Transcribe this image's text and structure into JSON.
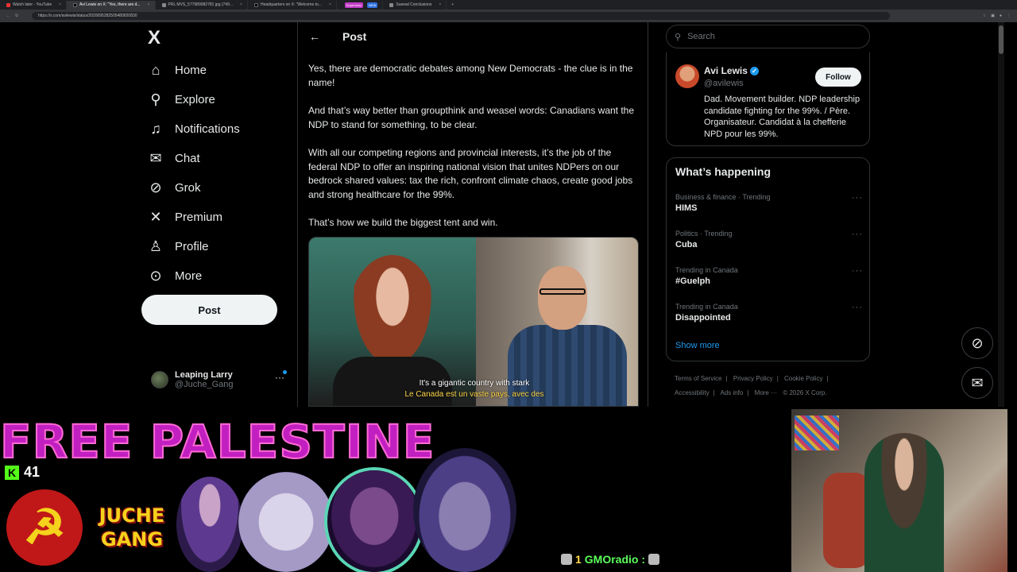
{
  "browser": {
    "tabs": [
      {
        "label": "Watch later - YouTube",
        "active": false
      },
      {
        "label": "Avi Lewis on X: \"Yes, there are d...",
        "active": true
      },
      {
        "label": "PRL MVS_577989082781 jpg (749...",
        "active": false
      },
      {
        "label": "Headquarters on X: \"Welcome to...",
        "active": false
      },
      {
        "label": "Supertonic",
        "active": false
      },
      {
        "label": "Suewal Conclusions",
        "active": false
      }
    ],
    "url": "https://x.com/avilewis/status/2020095282505480820830"
  },
  "sidebar": {
    "logo": "X",
    "nav": [
      {
        "label": "Home",
        "icon": "home-icon"
      },
      {
        "label": "Explore",
        "icon": "search-icon"
      },
      {
        "label": "Notifications",
        "icon": "bell-icon"
      },
      {
        "label": "Chat",
        "icon": "mail-icon"
      },
      {
        "label": "Grok",
        "icon": "grok-icon"
      },
      {
        "label": "Premium",
        "icon": "x-premium-icon"
      },
      {
        "label": "Profile",
        "icon": "person-icon"
      },
      {
        "label": "More",
        "icon": "more-circle-icon"
      }
    ],
    "post_button": "Post",
    "account": {
      "name": "Leaping Larry",
      "handle": "@Juche_Gang"
    }
  },
  "main": {
    "header_title": "Post",
    "paragraphs": [
      "Yes, there are democratic debates among New Democrats - the clue is in the name!",
      "And that’s way better than groupthink and weasel words: Canadians want the NDP to stand for something, to be clear.",
      "With all our competing regions and provincial interests, it’s the job of the federal NDP to offer an inspiring national vision that unites NDPers on our bedrock shared values: tax the rich, confront climate chaos, create good jobs and strong healthcare for the 99%.",
      "That’s how we build the biggest tent and win."
    ],
    "video": {
      "caption_en": "It's a gigantic country with stark",
      "caption_fr": "Le Canada est un vaste pays, avec des"
    }
  },
  "right": {
    "search_placeholder": "Search",
    "profile": {
      "name": "Avi Lewis",
      "handle": "@avilewis",
      "follow": "Follow",
      "bio": "Dad. Movement builder. NDP leadership candidate fighting for the 99%. / Père. Organisateur. Candidat à la chefferie NPD pour les 99%."
    },
    "trends_title": "What’s happening",
    "trends": [
      {
        "context": "Business & finance · Trending",
        "name": "HIMS"
      },
      {
        "context": "Politics · Trending",
        "name": "Cuba"
      },
      {
        "context": "Trending in Canada",
        "name": "#Guelph"
      },
      {
        "context": "Trending in Canada",
        "name": "Disappointed"
      }
    ],
    "show_more": "Show more",
    "footer": [
      "Terms of Service",
      "|",
      "Privacy Policy",
      "|",
      "Cookie Policy",
      "|",
      "Accessibility",
      "|",
      "Ads info",
      "|",
      "More ···",
      "© 2026 X Corp."
    ]
  },
  "overlay": {
    "banner": "FREE PALESTINE",
    "kick_count": "41",
    "juche_line1": "JUCHE",
    "juche_line2": "GANG",
    "chat_user": "GMOradio :",
    "chat_badge": "1"
  }
}
